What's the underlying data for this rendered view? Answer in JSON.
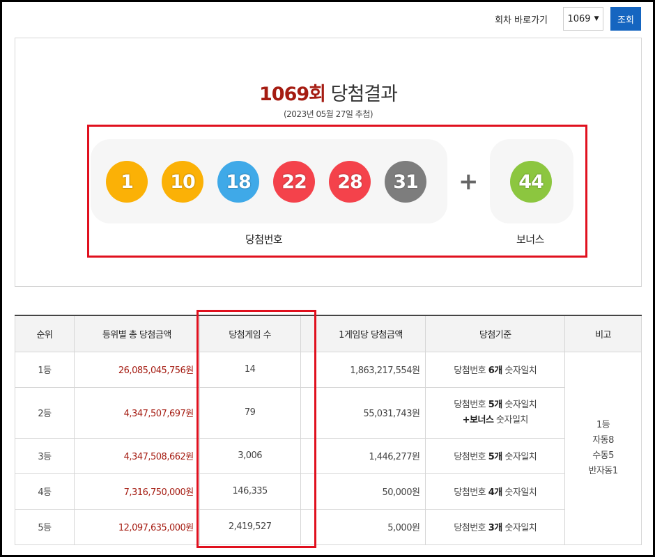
{
  "top": {
    "goto_label": "회차 바로가기",
    "round_select": "1069",
    "search_button": "조회"
  },
  "result": {
    "round": "1069회",
    "title_suffix": "당첨결과",
    "date": "(2023년 05월 27일 추첨)",
    "numbers": [
      "1",
      "10",
      "18",
      "22",
      "28",
      "31"
    ],
    "number_colors": [
      "#fbb106",
      "#fbb106",
      "#3fa9e8",
      "#f4424b",
      "#f4424b",
      "#7d7d7d"
    ],
    "plus": "+",
    "bonus": "44",
    "bonus_color": "#8cc63f",
    "numbers_caption": "당첨번호",
    "bonus_caption": "보너스"
  },
  "table": {
    "headers": [
      "순위",
      "등위별 총 당첨금액",
      "당첨게임 수",
      "1게임당 당첨금액",
      "당첨기준",
      "비고"
    ],
    "rows": [
      {
        "rank": "1등",
        "total": "26,085,045,756원",
        "winners": "14",
        "per_game": "1,863,217,554원",
        "crit_pre": "당첨번호 ",
        "crit_bold": "6개",
        "crit_post": " 숫자일치",
        "crit2_bold": "",
        "crit2_post": ""
      },
      {
        "rank": "2등",
        "total": "4,347,507,697원",
        "winners": "79",
        "per_game": "55,031,743원",
        "crit_pre": "당첨번호 ",
        "crit_bold": "5개",
        "crit_post": " 숫자일치",
        "crit2_bold": "+보너스",
        "crit2_post": " 숫자일치"
      },
      {
        "rank": "3등",
        "total": "4,347,508,662원",
        "winners": "3,006",
        "per_game": "1,446,277원",
        "crit_pre": "당첨번호 ",
        "crit_bold": "5개",
        "crit_post": " 숫자일치",
        "crit2_bold": "",
        "crit2_post": ""
      },
      {
        "rank": "4등",
        "total": "7,316,750,000원",
        "winners": "146,335",
        "per_game": "50,000원",
        "crit_pre": "당첨번호 ",
        "crit_bold": "4개",
        "crit_post": " 숫자일치",
        "crit2_bold": "",
        "crit2_post": ""
      },
      {
        "rank": "5등",
        "total": "12,097,635,000원",
        "winners": "2,419,527",
        "per_game": "5,000원",
        "crit_pre": "당첨번호 ",
        "crit_bold": "3개",
        "crit_post": " 숫자일치",
        "crit2_bold": "",
        "crit2_post": ""
      }
    ],
    "note_lines": [
      "1등",
      "자동8",
      "수동5",
      "반자동1"
    ]
  },
  "highlight_color": "#e0101e"
}
